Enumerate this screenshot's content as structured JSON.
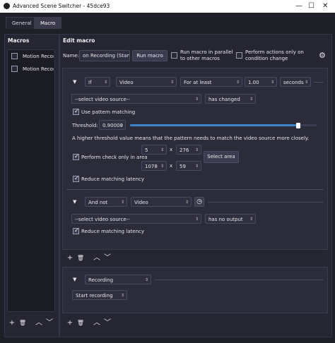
{
  "window": {
    "title": "Advanced Scene Switcher - 45dce93",
    "minimize": "—",
    "maximize": "☐",
    "close": "✕"
  },
  "tabs": [
    "General",
    "Macro"
  ],
  "macros": {
    "header": "Macros",
    "items": [
      {
        "label": "Motion Recor"
      },
      {
        "label": "Motion Recor"
      }
    ]
  },
  "edit": {
    "header": "Edit macro",
    "name_label": "Name:",
    "name_value": "on Recording (Start)",
    "run_button": "Run macro",
    "parallel_label": "Run macro in parallel to other macros",
    "perform_label": "Perform actions only on condition change",
    "gear_icon": "gear-icon"
  },
  "condition1": {
    "logic": "If",
    "type": "Video",
    "compare": "For at least",
    "duration": "1.00",
    "unit": "seconds",
    "source": "--select video source--",
    "check": "has changed",
    "pattern_label": "Use pattern matching",
    "threshold_label": "Threshold:",
    "threshold_value": "0.90000",
    "threshold_fraction": 0.9,
    "hint": "A higher threshold value means that the pattern needs to match the video source more closely.",
    "area_label": "Perform check only in area",
    "area_x": "5",
    "area_y": "276",
    "area_w": "1078",
    "area_h": "59",
    "x_sep": "x",
    "select_area": "Select area",
    "latency_label": "Reduce matching latency"
  },
  "condition2": {
    "logic": "And not",
    "type": "Video",
    "source": "--select video source--",
    "check": "has no output",
    "latency_label": "Reduce matching latency"
  },
  "action": {
    "type": "Recording",
    "value": "Start recording"
  },
  "icons": {
    "add": "+",
    "remove": "🗑",
    "up": "︿",
    "down": "﹀",
    "clock": "◷",
    "collapse": "▼"
  }
}
